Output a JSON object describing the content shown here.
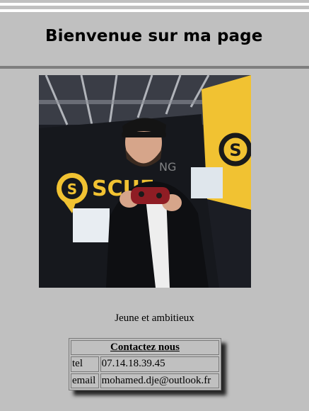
{
  "header": {
    "title": "Bienvenue sur ma page"
  },
  "photo": {
    "description_icon": "person-with-controller-photo",
    "banner_text": "SCUF GAMING"
  },
  "tagline": "Jeune et ambitieux",
  "contact": {
    "heading": "Contactez nous",
    "rows": [
      {
        "label": "tel",
        "value": "07.14.18.39.45"
      },
      {
        "label": "email",
        "value": "mohamed.dje@outlook.fr"
      }
    ]
  },
  "colors": {
    "background": "#c0c0c0",
    "separator": "#7e7e7e",
    "topline": "#ffffff",
    "scuf_yellow": "#f2c12e"
  }
}
